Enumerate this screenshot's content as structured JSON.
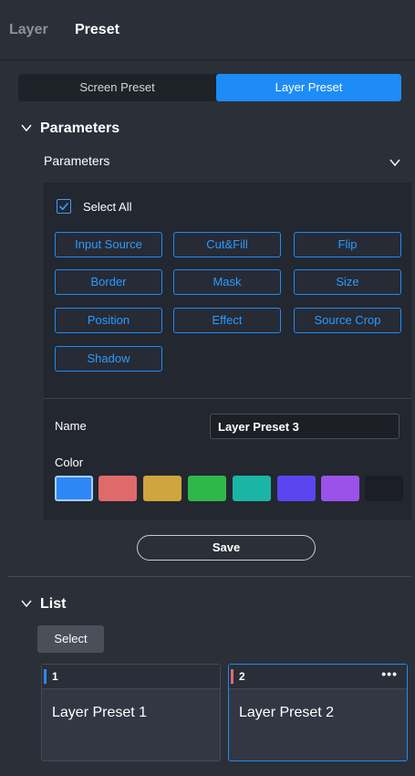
{
  "tabs": {
    "layer": "Layer",
    "preset": "Preset"
  },
  "segment": {
    "screen": "Screen Preset",
    "layer": "Layer Preset",
    "selected": "Layer Preset"
  },
  "parameters": {
    "title": "Parameters",
    "subtitle": "Parameters",
    "select_all": "Select All",
    "buttons": [
      "Input Source",
      "Cut&Fill",
      "Flip",
      "Border",
      "Mask",
      "Size",
      "Position",
      "Effect",
      "Source Crop",
      "Shadow"
    ],
    "name_label": "Name",
    "name_value": "Layer Preset 3",
    "color_label": "Color",
    "colors": [
      "#2f86f5",
      "#e06a6a",
      "#cfa63d",
      "#2fb84a",
      "#1bb5a6",
      "#5b45f0",
      "#9a52ea",
      "#1b1e26"
    ]
  },
  "save_label": "Save",
  "list": {
    "title": "List",
    "select_label": "Select",
    "cards": [
      {
        "num": "1",
        "title": "Layer Preset 1"
      },
      {
        "num": "2",
        "title": "Layer Preset 2",
        "more": "•••"
      }
    ]
  }
}
